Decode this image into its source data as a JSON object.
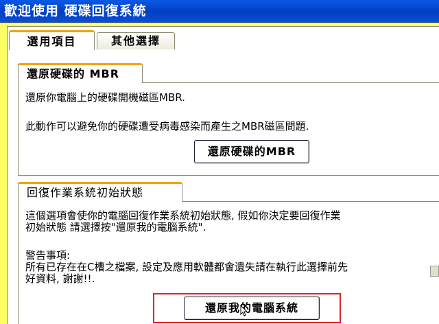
{
  "window": {
    "title": "歡迎使用 硬碟回復系統"
  },
  "tabs": [
    {
      "label": "選用項目"
    },
    {
      "label": "其他選擇"
    }
  ],
  "group_mbr": {
    "title": "還原硬碟的 MBR",
    "line1": "還原你電腦上的硬碟開機磁區MBR.",
    "line2": "此動作可以避免你的硬碟遭受病毒感染而產生之MBR磁區問題.",
    "button": "還原硬碟的MBR"
  },
  "group_restore": {
    "title": "回復作業系統初始狀態",
    "line1": "這個選項會使你的電腦回復作業系統初始狀態, 假如你決定要回復作業",
    "line2": "初始狀態 請選擇按\"還原我的電腦系統\".",
    "warn_title": "警告事項:",
    "warn_line1": "所有已存在在C槽之檔案, 設定及應用軟體都會遺失請在執行此選擇前先",
    "warn_line2": "好資料, 謝謝!!.",
    "button": "還原我的電腦系統"
  },
  "colors": {
    "accent": "#f3a200",
    "highlight": "#d8262a",
    "titlebar": "#0a4fd6"
  }
}
